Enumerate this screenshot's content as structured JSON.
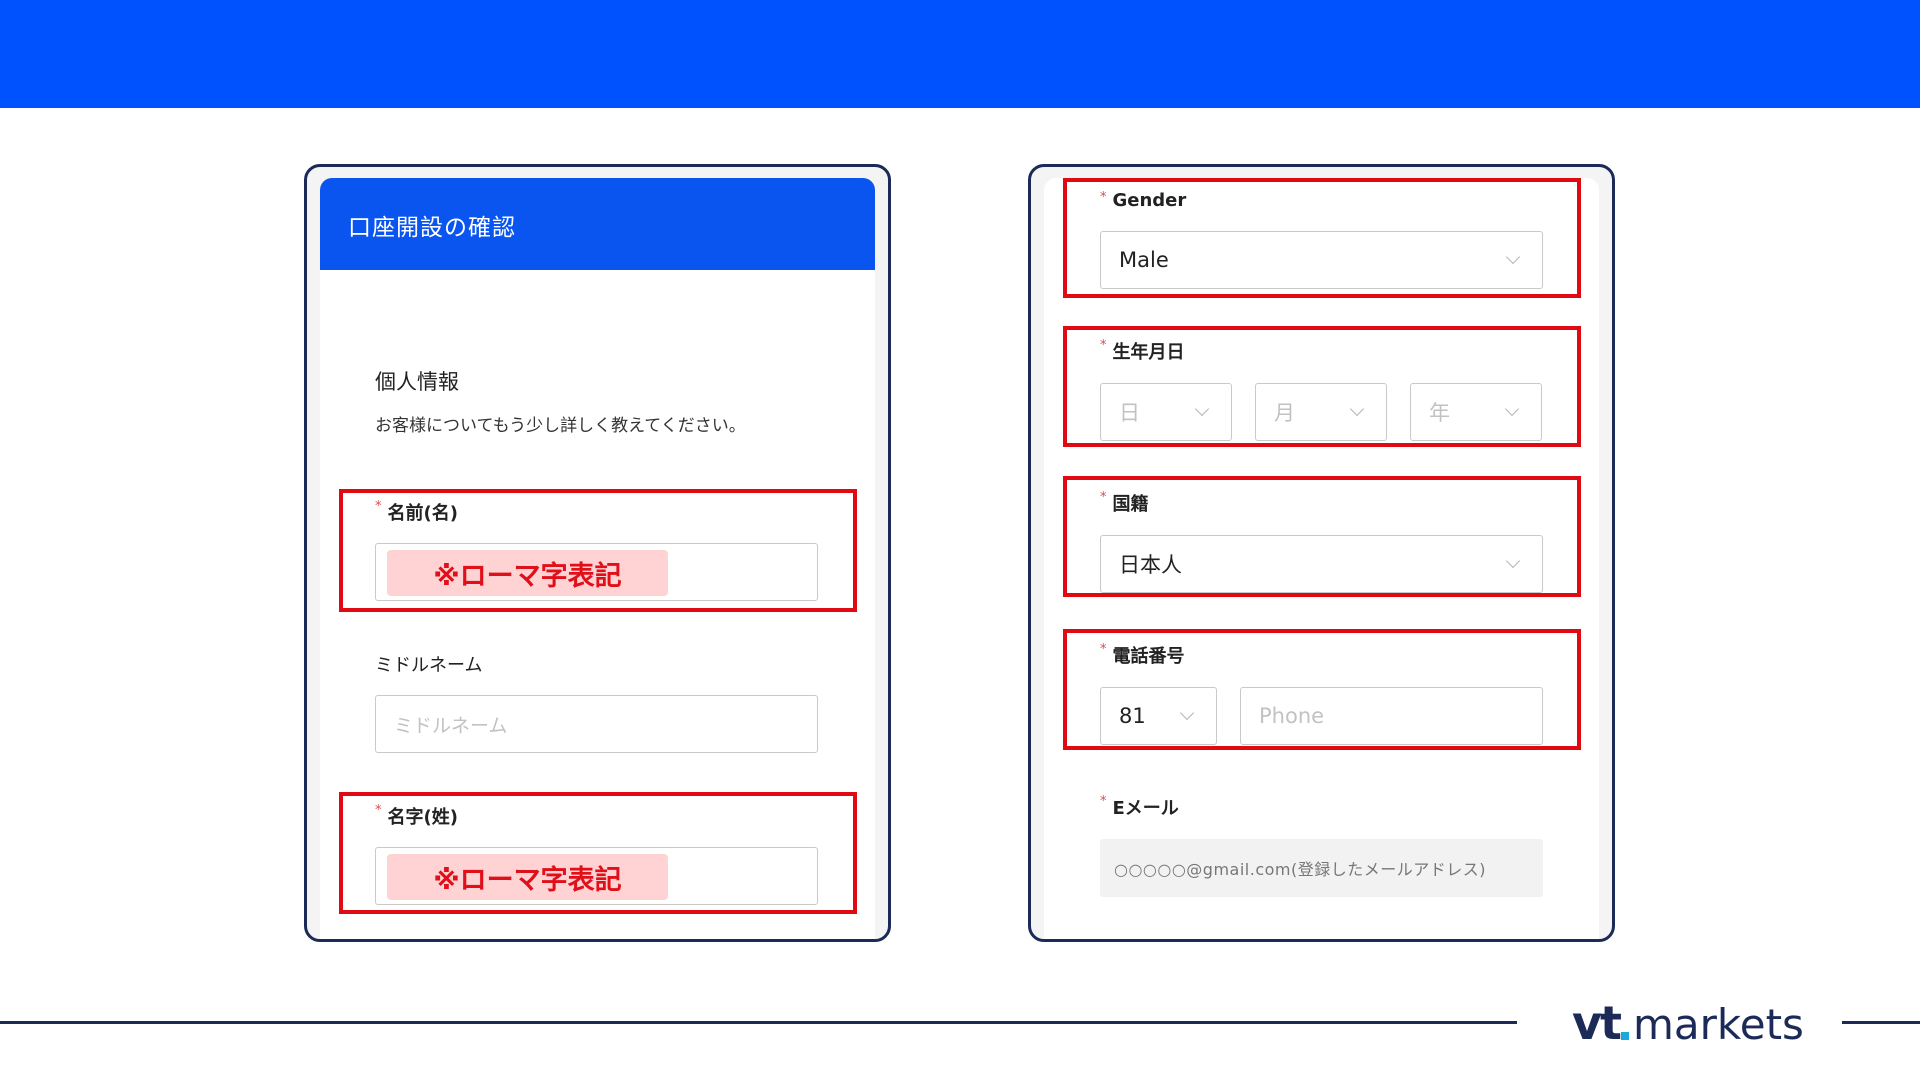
{
  "left_form": {
    "header_title": "口座開設の確認",
    "section_title": "個人情報",
    "section_desc": "お客様についてもう少し詳しく教えてください。",
    "first_name": {
      "required_mark": "*",
      "label": "名前(名)",
      "note": "※ローマ字表記"
    },
    "middle_name": {
      "label": "ミドルネーム",
      "placeholder": "ミドルネーム"
    },
    "last_name": {
      "required_mark": "*",
      "label": "名字(姓)",
      "note": "※ローマ字表記"
    }
  },
  "right_form": {
    "gender": {
      "required_mark": "*",
      "label": "Gender",
      "value": "Male"
    },
    "birthdate": {
      "required_mark": "*",
      "label": "生年月日",
      "day_placeholder": "日",
      "month_placeholder": "月",
      "year_placeholder": "年"
    },
    "nationality": {
      "required_mark": "*",
      "label": "国籍",
      "value": "日本人"
    },
    "phone": {
      "required_mark": "*",
      "label": "電話番号",
      "country_code": "81",
      "placeholder": "Phone"
    },
    "email": {
      "required_mark": "*",
      "label": "Eメール",
      "value": "○○○○○@gmail.com(登録したメールアドレス)"
    }
  },
  "logo": {
    "vt": "vt",
    "markets": "markets"
  },
  "colors": {
    "brand_blue": "#0052ff",
    "highlight_red": "#e00a13",
    "navy": "#1b2a57",
    "logo_accent": "#1aa9d9"
  }
}
